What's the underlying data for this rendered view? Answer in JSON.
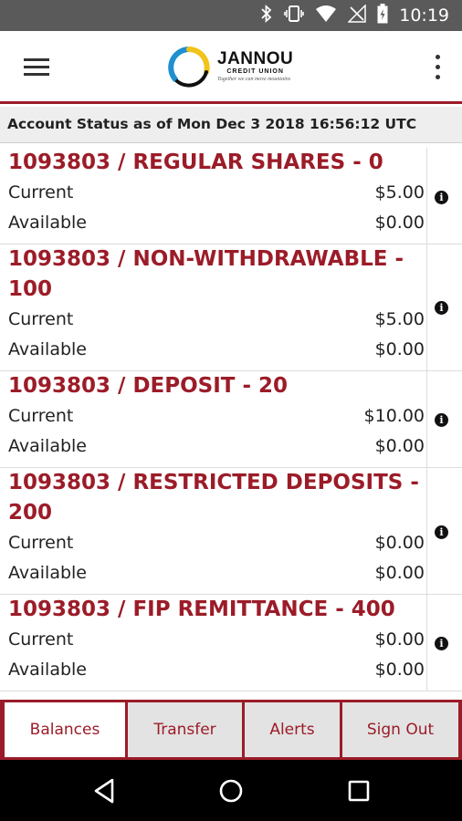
{
  "status_bar": {
    "time": "10:19",
    "icons": [
      "bluetooth-icon",
      "vibrate-icon",
      "wifi-icon",
      "no-signal-icon",
      "battery-charging-icon"
    ]
  },
  "app_bar": {
    "menu_icon": "hamburger-menu-icon",
    "overflow_icon": "more-vert-icon",
    "logo": {
      "name": "JANNOU",
      "subtitle": "CREDIT UNION",
      "tagline": "Together we can move mountains"
    }
  },
  "account_status": "Account Status as of Mon Dec 3 2018 16:56:12 UTC",
  "accounts": [
    {
      "title_line1": "1093803 / REGULAR SHARES - 0",
      "title_line2": "",
      "current_label": "Current",
      "current_value": "$5.00",
      "available_label": "Available",
      "available_value": "$0.00"
    },
    {
      "title_line1": "1093803 / NON-WITHDRAWABLE -",
      "title_line2": "100",
      "current_label": "Current",
      "current_value": "$5.00",
      "available_label": "Available",
      "available_value": "$0.00"
    },
    {
      "title_line1": "1093803 / DEPOSIT - 20",
      "title_line2": "",
      "current_label": "Current",
      "current_value": "$10.00",
      "available_label": "Available",
      "available_value": "$0.00"
    },
    {
      "title_line1": "1093803 / RESTRICTED DEPOSITS -",
      "title_line2": "200",
      "current_label": "Current",
      "current_value": "$0.00",
      "available_label": "Available",
      "available_value": "$0.00"
    },
    {
      "title_line1": "1093803 / FIP REMITTANCE - 400",
      "title_line2": "",
      "current_label": "Current",
      "current_value": "$0.00",
      "available_label": "Available",
      "available_value": "$0.00"
    }
  ],
  "tabs": {
    "balances": "Balances",
    "transfer": "Transfer",
    "alerts": "Alerts",
    "sign_out": "Sign Out",
    "active": "Balances"
  },
  "nav_bar": {
    "back_icon": "back-triangle-icon",
    "home_icon": "home-circle-icon",
    "recents_icon": "recents-square-icon"
  },
  "colors": {
    "brand": "#9b1c28",
    "status_bar": "#5a5a5a",
    "tab_inactive": "#e3e3e3"
  }
}
